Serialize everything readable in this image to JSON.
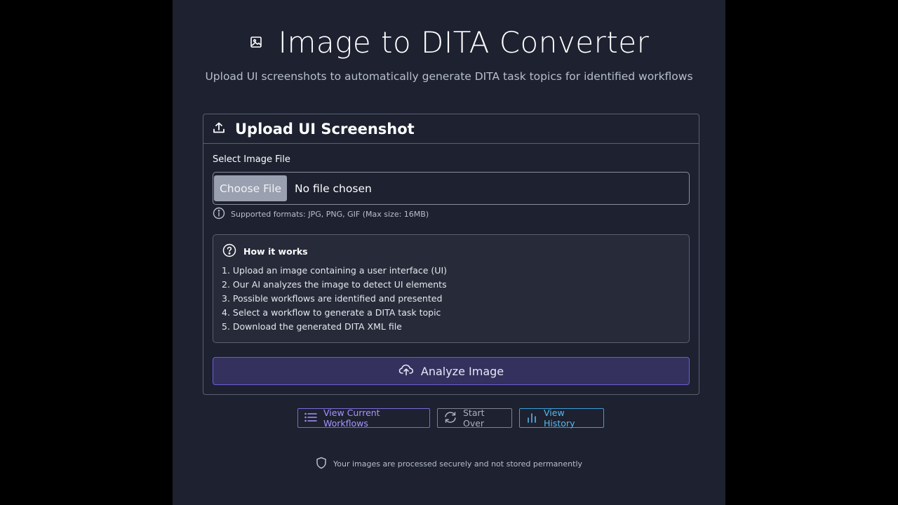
{
  "header": {
    "icon": "image-icon",
    "title": "Image to DITA Converter",
    "subtitle": "Upload UI screenshots to automatically generate DITA task topics for identified workflows"
  },
  "upload_card": {
    "icon": "upload-icon",
    "title": "Upload UI Screenshot",
    "field_label": "Select Image File",
    "choose_button": "Choose File",
    "file_status": "No file chosen",
    "hint_icon": "info-icon",
    "hint": "Supported formats: JPG, PNG, GIF (Max size: 16MB)",
    "how_it_works": {
      "icon": "question-circle-icon",
      "title": "How it works",
      "steps": [
        "1. Upload an image containing a user interface (UI)",
        "2. Our AI analyzes the image to detect UI elements",
        "3. Possible workflows are identified and presented",
        "4. Select a workflow to generate a DITA task topic",
        "5. Download the generated DITA XML file"
      ]
    },
    "analyze_button": {
      "icon": "cloud-upload-icon",
      "label": "Analyze Image"
    }
  },
  "actions": [
    {
      "icon": "list-icon",
      "label": "View Current Workflows",
      "color": "#a894ff"
    },
    {
      "icon": "refresh-icon",
      "label": "Start Over",
      "color": "#aab0bd"
    },
    {
      "icon": "bar-chart-icon",
      "label": "View History",
      "color": "#5ab8ec"
    }
  ],
  "footer": {
    "icon": "shield-icon",
    "text": "Your images are processed securely and not stored permanently"
  },
  "colors": {
    "background": "#1d2130",
    "accent": "#6d5cd6",
    "border": "#5a6070"
  }
}
